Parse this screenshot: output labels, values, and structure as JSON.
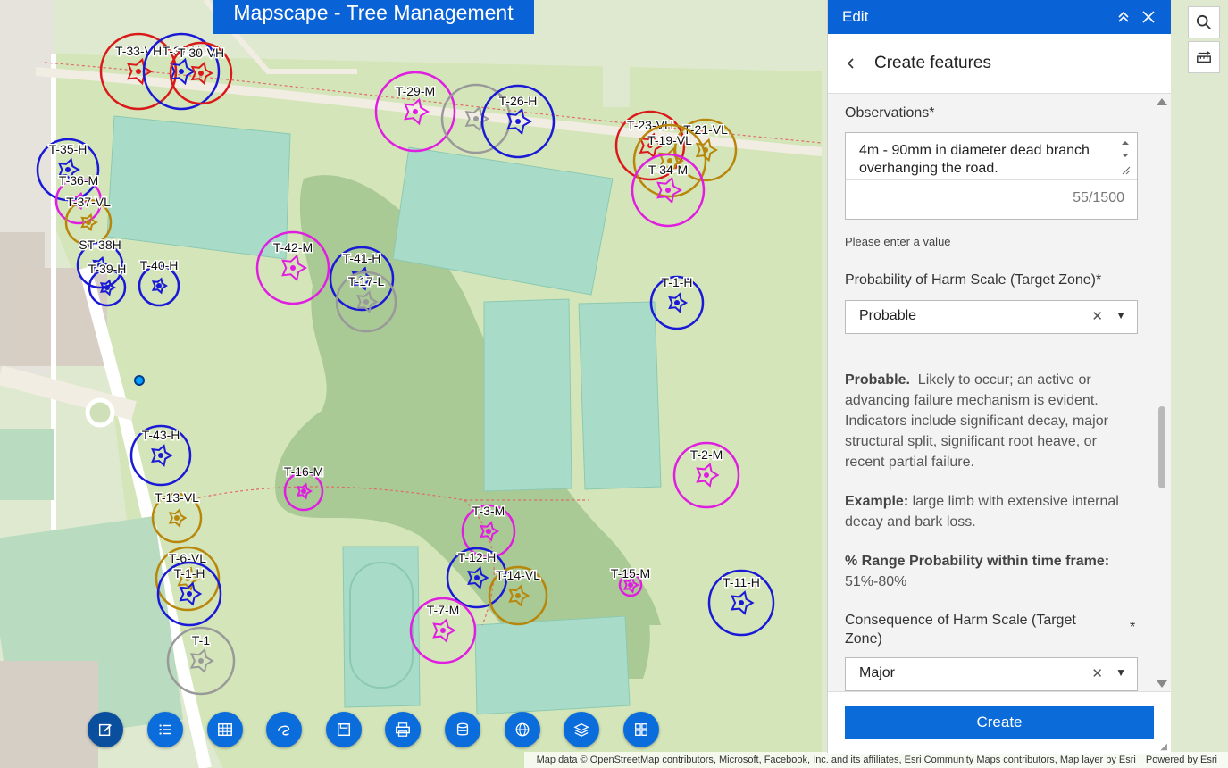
{
  "app": {
    "title": "Mapscape - Tree Management",
    "attribution": "Map data © OpenStreetMap contributors, Microsoft, Facebook, Inc. and its affiliates, Esri Community Maps contributors, Map layer by Esri",
    "powered_by": "Powered by Esri"
  },
  "toolbar": {
    "buttons": [
      {
        "icon": "edit-icon",
        "active": true
      },
      {
        "icon": "list-icon"
      },
      {
        "icon": "table-icon"
      },
      {
        "icon": "draw-icon"
      },
      {
        "icon": "save-icon"
      },
      {
        "icon": "print-icon"
      },
      {
        "icon": "database-icon"
      },
      {
        "icon": "globe-icon"
      },
      {
        "icon": "layers-icon"
      },
      {
        "icon": "grid-icon"
      }
    ]
  },
  "map_tools": [
    {
      "icon": "search-icon"
    },
    {
      "icon": "measure-icon"
    }
  ],
  "colors": {
    "very_high": "#d91a1a",
    "high": "#1a1ad6",
    "moderate": "#e01ee0",
    "very_low": "#b8860b",
    "low": "#999999",
    "accent": "#0a63d6"
  },
  "trees": [
    {
      "label": "T-33-VH",
      "cls": "VH"
    },
    {
      "label": "T-31-H",
      "cls": "H"
    },
    {
      "label": "T-30-VH",
      "cls": "VH"
    },
    {
      "label": "T-29-M",
      "cls": "M"
    },
    {
      "label": "",
      "cls": "L"
    },
    {
      "label": "T-26-H",
      "cls": "H"
    },
    {
      "label": "T-23-VH",
      "cls": "VH"
    },
    {
      "label": "T-21-VL",
      "cls": "VL"
    },
    {
      "label": "T-19-VL",
      "cls": "VL"
    },
    {
      "label": "T-34-M",
      "cls": "M"
    },
    {
      "label": "T-35-H",
      "cls": "H"
    },
    {
      "label": "T-36-M",
      "cls": "M"
    },
    {
      "label": "T-37-VL",
      "cls": "VL"
    },
    {
      "label": "ST-38H",
      "cls": "H"
    },
    {
      "label": "T-39-H",
      "cls": "H"
    },
    {
      "label": "T-40-H",
      "cls": "H"
    },
    {
      "label": "T-42-M",
      "cls": "M"
    },
    {
      "label": "T-41-H",
      "cls": "H"
    },
    {
      "label": "T-17-L",
      "cls": "L"
    },
    {
      "label": "T-1-H",
      "cls": "H"
    },
    {
      "label": "T-43-H",
      "cls": "H"
    },
    {
      "label": "T-16-M",
      "cls": "M"
    },
    {
      "label": "T-2-M",
      "cls": "M"
    },
    {
      "label": "T-13-VL",
      "cls": "VL"
    },
    {
      "label": "T-3-M",
      "cls": "M"
    },
    {
      "label": "T-6-VL",
      "cls": "VL"
    },
    {
      "label": "T-1-H",
      "cls": "H"
    },
    {
      "label": "T-12-H",
      "cls": "H"
    },
    {
      "label": "T-14-VL",
      "cls": "VL"
    },
    {
      "label": "T-15-M",
      "cls": "M"
    },
    {
      "label": "T-11-H",
      "cls": "H"
    },
    {
      "label": "T-7-M",
      "cls": "M"
    },
    {
      "label": "T-1",
      "cls": "L"
    }
  ],
  "panel": {
    "header_title": "Edit",
    "subtitle": "Create features",
    "observations": {
      "label": "Observations*",
      "value": "4m - 90mm in diameter dead branch overhanging the road.",
      "counter": "55/1500",
      "hint": "Please enter a value"
    },
    "probability": {
      "label": "Probability of Harm Scale (Target Zone)*",
      "value": "Probable",
      "desc_title": "Probable.",
      "desc_text": "Likely to occur; an active or advancing failure mechanism is evident. Indicators include significant decay, major structural split, significant root heave, or recent partial failure.",
      "example_title": "Example:",
      "example_text": "large limb with extensive internal decay and bark loss.",
      "range_title": "% Range Probability within time frame:",
      "range_value": "51%-80%"
    },
    "consequence": {
      "label": "Consequence of Harm Scale (Target Zone)",
      "required_mark": "*",
      "value": "Major"
    },
    "create_label": "Create"
  }
}
